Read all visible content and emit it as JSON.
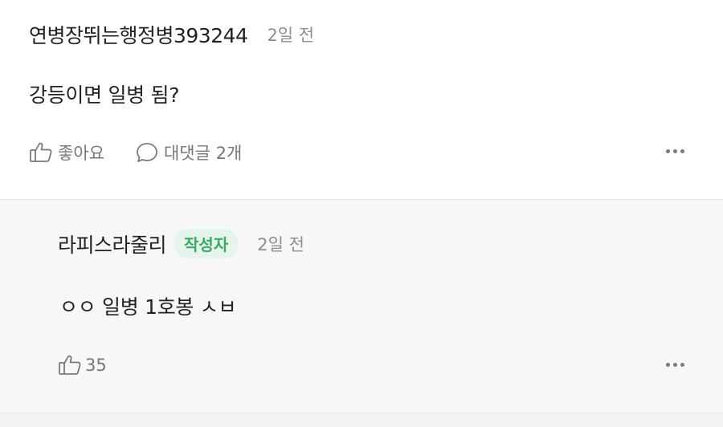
{
  "comments": [
    {
      "author": "연병장뛰는행정병393244",
      "time": "2일 전",
      "text": "강등이면 일병 됨?",
      "like_label": "좋아요",
      "reply_label": "대댓글 2개",
      "more_icon": "more-horizontal-icon"
    },
    {
      "author": "라피스라줄리",
      "badge": "작성자",
      "time": "2일 전",
      "text": "ㅇㅇ 일병 1호봉 ㅅㅂ",
      "like_count": "35",
      "more_icon": "more-horizontal-icon"
    }
  ],
  "colors": {
    "badge_text": "#3aaa68",
    "badge_bg": "#e6f5ec",
    "reply_bg": "#f7f7f7",
    "muted": "#8e8e8e"
  }
}
